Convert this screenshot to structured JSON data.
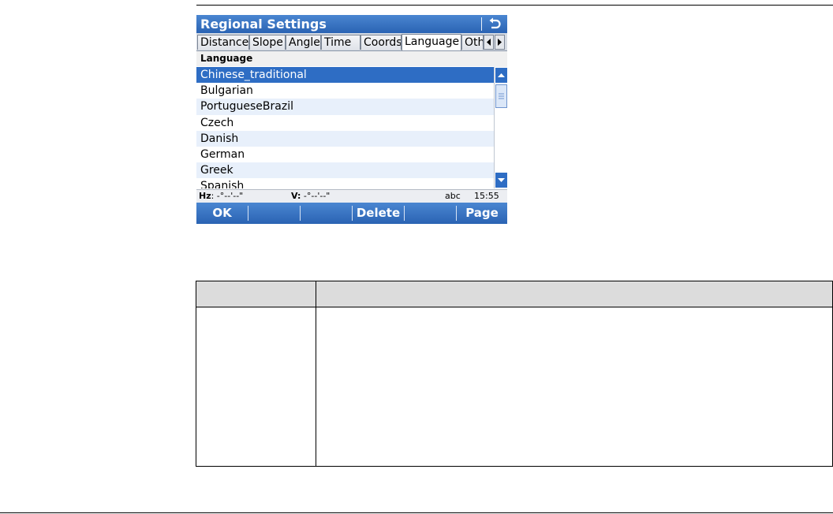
{
  "window": {
    "title": "Regional Settings"
  },
  "tabs": [
    {
      "label": "Distance",
      "active": false
    },
    {
      "label": "Slope",
      "active": false
    },
    {
      "label": "Angle",
      "active": false
    },
    {
      "label": "Time",
      "active": false
    },
    {
      "label": "Coords",
      "active": false
    },
    {
      "label": "Language",
      "active": true
    },
    {
      "label": "Oth",
      "active": false
    }
  ],
  "list": {
    "header": "Language",
    "items": [
      {
        "label": "Chinese_traditional",
        "selected": true
      },
      {
        "label": "Bulgarian",
        "selected": false
      },
      {
        "label": "PortugueseBrazil",
        "selected": false
      },
      {
        "label": "Czech",
        "selected": false
      },
      {
        "label": "Danish",
        "selected": false
      },
      {
        "label": "German",
        "selected": false
      },
      {
        "label": "Greek",
        "selected": false
      },
      {
        "label": "Spanish",
        "selected": false
      }
    ]
  },
  "statusbar": {
    "hz_label": "Hz",
    "hz_value": ": -°--'--\"",
    "v_label": "V:",
    "v_value": " -°--'--\"",
    "input_mode": "abc",
    "time": "15:55"
  },
  "softkeys": {
    "ok": "OK",
    "delete": "Delete",
    "page": "Page"
  },
  "colors": {
    "accent": "#2e6dc4",
    "row_alt": "#e8f0fb",
    "table_header": "#dcdcdc"
  }
}
